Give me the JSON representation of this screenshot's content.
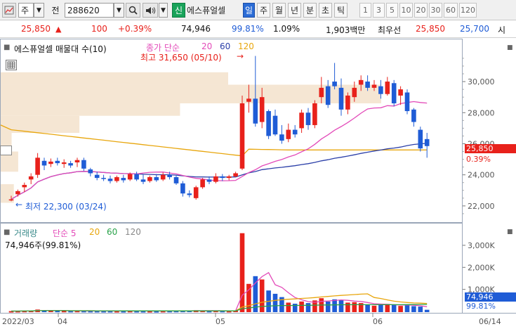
{
  "toolbar": {
    "market": "주",
    "prev_label": "전",
    "code": "288620",
    "new_badge": "신",
    "stock_name": "에스퓨얼셀",
    "periods": [
      "일",
      "주",
      "월",
      "년",
      "분",
      "초",
      "틱"
    ],
    "selected_period": "일",
    "numbers": [
      "1",
      "3",
      "5",
      "10",
      "20",
      "30",
      "60",
      "120"
    ]
  },
  "quote": {
    "price": "25,850",
    "change": "100",
    "change_pct": "+0.39%",
    "volume": "74,946",
    "vol_ratio": "99.81%",
    "turnover": "1.09%",
    "amount": "1,903백만",
    "best_ask_label": "최우선",
    "best_ask": "25,850",
    "best_bid": "25,700",
    "open_label": "시"
  },
  "price_panel": {
    "title": "에스퓨얼셀 매물대 수(10)",
    "ma_label": "종가 단순",
    "ma_periods": [
      "20",
      "60",
      "120"
    ],
    "high_label": "최고 31,650 (05/10)",
    "low_label": "최저 22,300 (03/24)",
    "last_price_tag": "25,850",
    "last_pct_tag": "0.39%",
    "colors": {
      "up": "#e8211b",
      "down": "#1f5cd6",
      "ma20": "#e34bb9",
      "ma60": "#2b3fa8",
      "ma120": "#e8a60d"
    }
  },
  "volume_panel": {
    "label": "거래량",
    "ma_label": "단순 5",
    "ma_periods": [
      "20",
      "60",
      "120"
    ],
    "current": "74,946주(99.81%)",
    "tag_volume": "74,946",
    "tag_pct": "99.81%"
  },
  "x_axis": [
    "2022/03",
    "04",
    "05",
    "06",
    "06/14"
  ],
  "chart_data": {
    "type": "candlestick",
    "title": "에스퓨얼셀 매물대 수(10)",
    "y_ticks": [
      22000,
      24000,
      26000,
      28000,
      30000
    ],
    "ylim": [
      21000,
      32400
    ],
    "volume_ticks": [
      "1,000K",
      "2,000K",
      "3,000K"
    ],
    "volume_ylim": [
      0,
      3700000
    ],
    "price_volume_profile": [
      {
        "low": 29800,
        "high": 30600,
        "weight": 0.52
      },
      {
        "low": 28600,
        "high": 29800,
        "weight": 0.87
      },
      {
        "low": 27800,
        "high": 28600,
        "weight": 0.41
      },
      {
        "low": 26700,
        "high": 27800,
        "weight": 0.18
      },
      {
        "low": 25750,
        "high": 26700,
        "weight": 0.025
      },
      {
        "low": 24200,
        "high": 25500,
        "weight": 0.04
      },
      {
        "low": 22200,
        "high": 23400,
        "weight": 0.03
      }
    ],
    "candles": [
      {
        "o": 22380,
        "h": 22650,
        "l": 22300,
        "c": 22420,
        "v": 15000
      },
      {
        "o": 22750,
        "h": 23050,
        "l": 22600,
        "c": 22950,
        "v": 19000
      },
      {
        "o": 23200,
        "h": 23500,
        "l": 22900,
        "c": 23350,
        "v": 26000
      },
      {
        "o": 23700,
        "h": 24100,
        "l": 23400,
        "c": 23900,
        "v": 30000
      },
      {
        "o": 24000,
        "h": 25400,
        "l": 23800,
        "c": 25100,
        "v": 85000
      },
      {
        "o": 24900,
        "h": 25100,
        "l": 24300,
        "c": 24600,
        "v": 40000
      },
      {
        "o": 24700,
        "h": 25050,
        "l": 24500,
        "c": 24850,
        "v": 35000
      },
      {
        "o": 24900,
        "h": 25100,
        "l": 24600,
        "c": 24750,
        "v": 28000
      },
      {
        "o": 24700,
        "h": 25000,
        "l": 24450,
        "c": 24800,
        "v": 25000
      },
      {
        "o": 24750,
        "h": 24900,
        "l": 24450,
        "c": 24600,
        "v": 22000
      },
      {
        "o": 24800,
        "h": 25100,
        "l": 24500,
        "c": 24950,
        "v": 27000
      },
      {
        "o": 24950,
        "h": 25100,
        "l": 24250,
        "c": 24400,
        "v": 24000
      },
      {
        "o": 24350,
        "h": 24450,
        "l": 23900,
        "c": 24100,
        "v": 21000
      },
      {
        "o": 24000,
        "h": 24200,
        "l": 23650,
        "c": 23800,
        "v": 20000
      },
      {
        "o": 23800,
        "h": 24000,
        "l": 23600,
        "c": 23750,
        "v": 18000
      },
      {
        "o": 23750,
        "h": 23950,
        "l": 23450,
        "c": 23600,
        "v": 19000
      },
      {
        "o": 23600,
        "h": 23950,
        "l": 23500,
        "c": 23850,
        "v": 17000
      },
      {
        "o": 23800,
        "h": 24000,
        "l": 23500,
        "c": 23650,
        "v": 16000
      },
      {
        "o": 23700,
        "h": 24150,
        "l": 23600,
        "c": 24050,
        "v": 22000
      },
      {
        "o": 24050,
        "h": 24200,
        "l": 23600,
        "c": 23700,
        "v": 18000
      },
      {
        "o": 23700,
        "h": 24000,
        "l": 23400,
        "c": 23550,
        "v": 17000
      },
      {
        "o": 23600,
        "h": 23950,
        "l": 23500,
        "c": 23850,
        "v": 16000
      },
      {
        "o": 23850,
        "h": 24050,
        "l": 23550,
        "c": 23650,
        "v": 15000
      },
      {
        "o": 23700,
        "h": 24150,
        "l": 23600,
        "c": 24000,
        "v": 21000
      },
      {
        "o": 24000,
        "h": 24200,
        "l": 23700,
        "c": 23850,
        "v": 23000
      },
      {
        "o": 23850,
        "h": 24000,
        "l": 23350,
        "c": 23450,
        "v": 26000
      },
      {
        "o": 23450,
        "h": 23600,
        "l": 22600,
        "c": 22800,
        "v": 30000
      },
      {
        "o": 22800,
        "h": 23000,
        "l": 22550,
        "c": 22700,
        "v": 32000
      },
      {
        "o": 22500,
        "h": 23300,
        "l": 22400,
        "c": 23200,
        "v": 55000
      },
      {
        "o": 23200,
        "h": 23800,
        "l": 23100,
        "c": 23700,
        "v": 35000
      },
      {
        "o": 23700,
        "h": 23900,
        "l": 23400,
        "c": 23550,
        "v": 22000
      },
      {
        "o": 23550,
        "h": 24100,
        "l": 23450,
        "c": 23900,
        "v": 30000
      },
      {
        "o": 23900,
        "h": 24050,
        "l": 23600,
        "c": 23800,
        "v": 25000
      },
      {
        "o": 23800,
        "h": 24000,
        "l": 23650,
        "c": 23900,
        "v": 20000
      },
      {
        "o": 23900,
        "h": 24200,
        "l": 23850,
        "c": 24100,
        "v": 45000
      },
      {
        "o": 24400,
        "h": 29100,
        "l": 24300,
        "c": 28600,
        "v": 3550000
      },
      {
        "o": 28700,
        "h": 29800,
        "l": 28000,
        "c": 28900,
        "v": 1250000
      },
      {
        "o": 28900,
        "h": 31650,
        "l": 27100,
        "c": 27300,
        "v": 1600000
      },
      {
        "o": 27400,
        "h": 29600,
        "l": 27000,
        "c": 29000,
        "v": 1450000
      },
      {
        "o": 28100,
        "h": 28200,
        "l": 26300,
        "c": 26500,
        "v": 950000
      },
      {
        "o": 27800,
        "h": 28200,
        "l": 26500,
        "c": 26600,
        "v": 800000
      },
      {
        "o": 26600,
        "h": 27200,
        "l": 26000,
        "c": 26200,
        "v": 650000
      },
      {
        "o": 26300,
        "h": 27300,
        "l": 26100,
        "c": 26900,
        "v": 400000
      },
      {
        "o": 26900,
        "h": 27200,
        "l": 26400,
        "c": 26600,
        "v": 350000
      },
      {
        "o": 27000,
        "h": 28200,
        "l": 26700,
        "c": 28000,
        "v": 450000
      },
      {
        "o": 28000,
        "h": 28300,
        "l": 26900,
        "c": 27200,
        "v": 380000
      },
      {
        "o": 27200,
        "h": 28800,
        "l": 27000,
        "c": 28600,
        "v": 500000
      },
      {
        "o": 29000,
        "h": 30300,
        "l": 28600,
        "c": 29600,
        "v": 600000
      },
      {
        "o": 29700,
        "h": 30100,
        "l": 28300,
        "c": 28500,
        "v": 450000
      },
      {
        "o": 30000,
        "h": 31200,
        "l": 29500,
        "c": 29700,
        "v": 550000
      },
      {
        "o": 29600,
        "h": 30200,
        "l": 27800,
        "c": 28200,
        "v": 520000
      },
      {
        "o": 28200,
        "h": 29300,
        "l": 27900,
        "c": 29100,
        "v": 400000
      },
      {
        "o": 29000,
        "h": 30000,
        "l": 28700,
        "c": 29600,
        "v": 420000
      },
      {
        "o": 29800,
        "h": 30400,
        "l": 29400,
        "c": 30100,
        "v": 380000
      },
      {
        "o": 30000,
        "h": 30400,
        "l": 29400,
        "c": 29600,
        "v": 300000
      },
      {
        "o": 29600,
        "h": 30100,
        "l": 29400,
        "c": 29800,
        "v": 260000
      },
      {
        "o": 29700,
        "h": 30100,
        "l": 28900,
        "c": 29200,
        "v": 320000
      },
      {
        "o": 29200,
        "h": 30300,
        "l": 29100,
        "c": 30000,
        "v": 340000
      },
      {
        "o": 29900,
        "h": 30100,
        "l": 28400,
        "c": 28600,
        "v": 300000
      },
      {
        "o": 29100,
        "h": 29700,
        "l": 28500,
        "c": 29500,
        "v": 250000
      },
      {
        "o": 29300,
        "h": 29500,
        "l": 27900,
        "c": 28100,
        "v": 280000
      },
      {
        "o": 28200,
        "h": 28300,
        "l": 27100,
        "c": 27400,
        "v": 240000
      },
      {
        "o": 26900,
        "h": 27100,
        "l": 25500,
        "c": 25700,
        "v": 220000
      },
      {
        "o": 26300,
        "h": 26700,
        "l": 25100,
        "c": 25850,
        "v": 75000
      }
    ]
  }
}
